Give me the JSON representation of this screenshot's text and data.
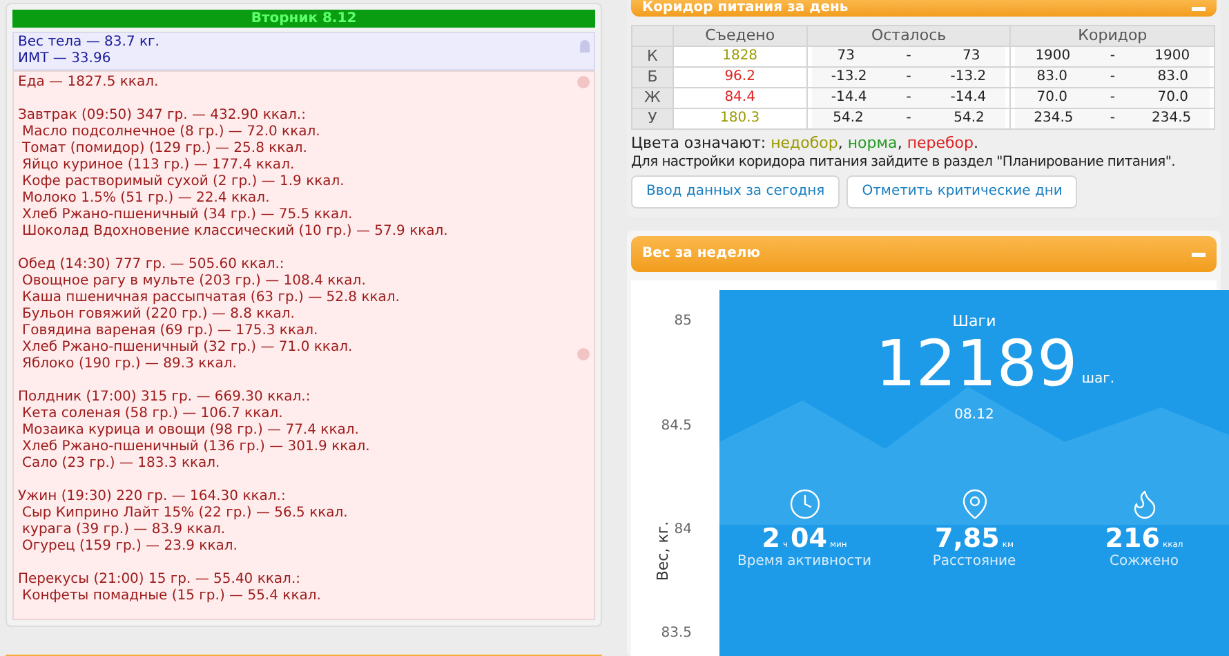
{
  "day_panel": {
    "title": "Вторник 8.12",
    "weight": "Вес тела — 83.7 кг.",
    "bmi": "ИМТ — 33.96",
    "food_total": "Еда — 1827.5 ккал.",
    "meals": [
      {
        "title": "Завтрак (09:50) 347 гр. — 432.90 ккал.:",
        "items": [
          "Масло подсолнечное (8 гр.) — 72.0 ккал.",
          "Томат (помидор) (129 гр.) — 25.8 ккал.",
          "Яйцо куриное (113 гр.) — 177.4 ккал.",
          "Кофе растворимый сухой (2 гр.) — 1.9 ккал.",
          "Молоко 1.5% (51 гр.) — 22.4 ккал.",
          "Хлеб Ржано-пшеничный (34 гр.) — 75.5 ккал.",
          "Шоколад Вдохновение классический (10 гр.) — 57.9 ккал."
        ]
      },
      {
        "title": "Обед (14:30) 777 гр. — 505.60 ккал.:",
        "items": [
          "Овощное рагу в мульте (203 гр.) — 108.4 ккал.",
          "Каша пшеничная рассыпчатая (63 гр.) — 52.8 ккал.",
          "Бульон говяжий (220 гр.) — 8.8 ккал.",
          "Говядина вареная (69 гр.) — 175.3 ккал.",
          "Хлеб Ржано-пшеничный (32 гр.) — 71.0 ккал.",
          "Яблоко (190 гр.) — 89.3 ккал."
        ]
      },
      {
        "title": "Полдник (17:00) 315 гр. — 669.30 ккал.:",
        "items": [
          "Кета соленая (58 гр.) — 106.7 ккал.",
          "Мозаика курица и овощи (98 гр.) — 77.4 ккал.",
          "Хлеб Ржано-пшеничный (136 гр.) — 301.9 ккал.",
          "Сало (23 гр.) — 183.3 ккал."
        ]
      },
      {
        "title": "Ужин (19:30) 220 гр. — 164.30 ккал.:",
        "items": [
          "Сыр Киприно Лайт 15% (22 гр.) — 56.5 ккал.",
          "курага (39 гр.) — 83.9 ккал.",
          "Огурец (159 гр.) — 23.9 ккал."
        ]
      },
      {
        "title": "Перекусы (21:00) 15 гр. — 55.40 ккал.:",
        "items": [
          "Конфеты помадные (15 гр.) — 55.4 ккал."
        ]
      }
    ]
  },
  "corridor_panel": {
    "title": "Коридор питания за день",
    "columns": [
      "Съедено",
      "Осталось",
      "Коридор"
    ],
    "rows": [
      {
        "label": "К",
        "eaten": "1828",
        "color": "#999900",
        "remaining": {
          "from": "73",
          "sep": "-",
          "to": "73"
        },
        "corridor": {
          "from": "1900",
          "sep": "-",
          "to": "1900"
        }
      },
      {
        "label": "Б",
        "eaten": "96.2",
        "color": "#dd2222",
        "remaining": {
          "from": "-13.2",
          "sep": "-",
          "to": "-13.2"
        },
        "corridor": {
          "from": "83.0",
          "sep": "-",
          "to": "83.0"
        }
      },
      {
        "label": "Ж",
        "eaten": "84.4",
        "color": "#dd2222",
        "remaining": {
          "from": "-14.4",
          "sep": "-",
          "to": "-14.4"
        },
        "corridor": {
          "from": "70.0",
          "sep": "-",
          "to": "70.0"
        }
      },
      {
        "label": "У",
        "eaten": "180.3",
        "color": "#999900",
        "remaining": {
          "from": "54.2",
          "sep": "-",
          "to": "54.2"
        },
        "corridor": {
          "from": "234.5",
          "sep": "-",
          "to": "234.5"
        }
      }
    ],
    "legend": [
      {
        "text": "Цвета означают: "
      },
      {
        "text": "недобор",
        "color": "#999900"
      },
      {
        "text": ", "
      },
      {
        "text": "норма",
        "color": "#229922"
      },
      {
        "text": ", "
      },
      {
        "text": "перебор",
        "color": "#dd2222"
      },
      {
        "text": "."
      }
    ],
    "hint": "Для настройки коридора питания зайдите в раздел \"Планирование питания\".",
    "buttons": [
      "Ввод данных за сегодня",
      "Отметить критические дни"
    ]
  },
  "weight_panel": {
    "title": "Вес за неделю",
    "ylabel": "Вес, кг.",
    "yticks": [
      "85",
      "84.5",
      "84",
      "83.5"
    ]
  },
  "steps_screenshot": {
    "title": "Шаги",
    "value": "12189",
    "unit": "шаг.",
    "date": "08.12",
    "stats": [
      {
        "kind": "time",
        "parts": [
          {
            "text": "2",
            "kind": "number"
          },
          {
            "text": "ч",
            "kind": "unit"
          },
          {
            "text": "04",
            "kind": "number"
          },
          {
            "text": "мин",
            "kind": "unit"
          }
        ],
        "label": "Время активности"
      },
      {
        "kind": "distance",
        "parts": [
          {
            "text": "7,85",
            "kind": "number"
          },
          {
            "text": "км",
            "kind": "unit"
          }
        ],
        "label": "Расстояние"
      },
      {
        "kind": "burned",
        "parts": [
          {
            "text": "216",
            "kind": "number"
          },
          {
            "text": "ккал",
            "kind": "unit"
          }
        ],
        "label": "Сожжено"
      }
    ]
  }
}
